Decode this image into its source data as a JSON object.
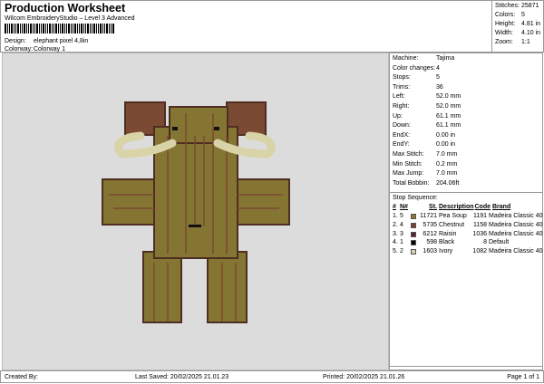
{
  "header": {
    "title": "Production Worksheet",
    "subtitle": "Wilcom EmbroideryStudio – Level 3 Advanced",
    "design_label": "Design:",
    "design_value": "elephant pixel 4,8in",
    "colorway_label": "Colorway:",
    "colorway_value": "Colorway 1"
  },
  "stats": [
    {
      "k": "Stitches:",
      "v": "25871"
    },
    {
      "k": "Colors:",
      "v": "5"
    },
    {
      "k": "Height:",
      "v": "4.81 in"
    },
    {
      "k": "Width:",
      "v": "4.10 in"
    },
    {
      "k": "Zoom:",
      "v": "1:1"
    }
  ],
  "info": [
    {
      "k": "Machine:",
      "v": "Tajima"
    },
    {
      "k": "Color changes:",
      "v": "4"
    },
    {
      "k": "Stops:",
      "v": "5"
    },
    {
      "k": "Trims:",
      "v": "36"
    },
    {
      "k": "Left:",
      "v": "52.0 mm"
    },
    {
      "k": "Right:",
      "v": "52.0 mm"
    },
    {
      "k": "Up:",
      "v": "61.1 mm"
    },
    {
      "k": "Down:",
      "v": "61.1 mm"
    },
    {
      "k": "EndX:",
      "v": "0.00 in"
    },
    {
      "k": "EndY:",
      "v": "0.00 in"
    },
    {
      "k": "Max Stitch:",
      "v": "7.0 mm"
    },
    {
      "k": "Min Stitch:",
      "v": "0.2 mm"
    },
    {
      "k": "Max Jump:",
      "v": "7.0 mm"
    },
    {
      "k": "Total Bobbin:",
      "v": "204.06ft"
    }
  ],
  "stop_sequence": {
    "title": "Stop Sequence:",
    "headers": [
      "#",
      "N#",
      "St.",
      "Description",
      "Code",
      "Brand"
    ],
    "rows": [
      {
        "n": "1.",
        "nn": "5",
        "color": "#8c7a2e",
        "st": "11721",
        "desc": "Pea Soup",
        "code": "1191",
        "brand": "Madeira Classic 40"
      },
      {
        "n": "2.",
        "nn": "4",
        "color": "#7a4030",
        "st": "5735",
        "desc": "Chestnut",
        "code": "1158",
        "brand": "Madeira Classic 40"
      },
      {
        "n": "3.",
        "nn": "3",
        "color": "#5a2228",
        "st": "6212",
        "desc": "Raisin",
        "code": "1036",
        "brand": "Madeira Classic 40"
      },
      {
        "n": "4.",
        "nn": "1",
        "color": "#000000",
        "st": "598",
        "desc": "Black",
        "code": "8",
        "brand": "Default"
      },
      {
        "n": "5.",
        "nn": "2",
        "color": "#d8ceb0",
        "st": "1603",
        "desc": "Ivory",
        "code": "1082",
        "brand": "Madeira Classic 40"
      }
    ]
  },
  "footer": {
    "created_by": "Created By:",
    "last_saved": "Last Saved: 20/02/2025 21.01.23",
    "printed": "Printed: 20/02/2025 21.01.26",
    "page": "Page 1 of 1"
  }
}
